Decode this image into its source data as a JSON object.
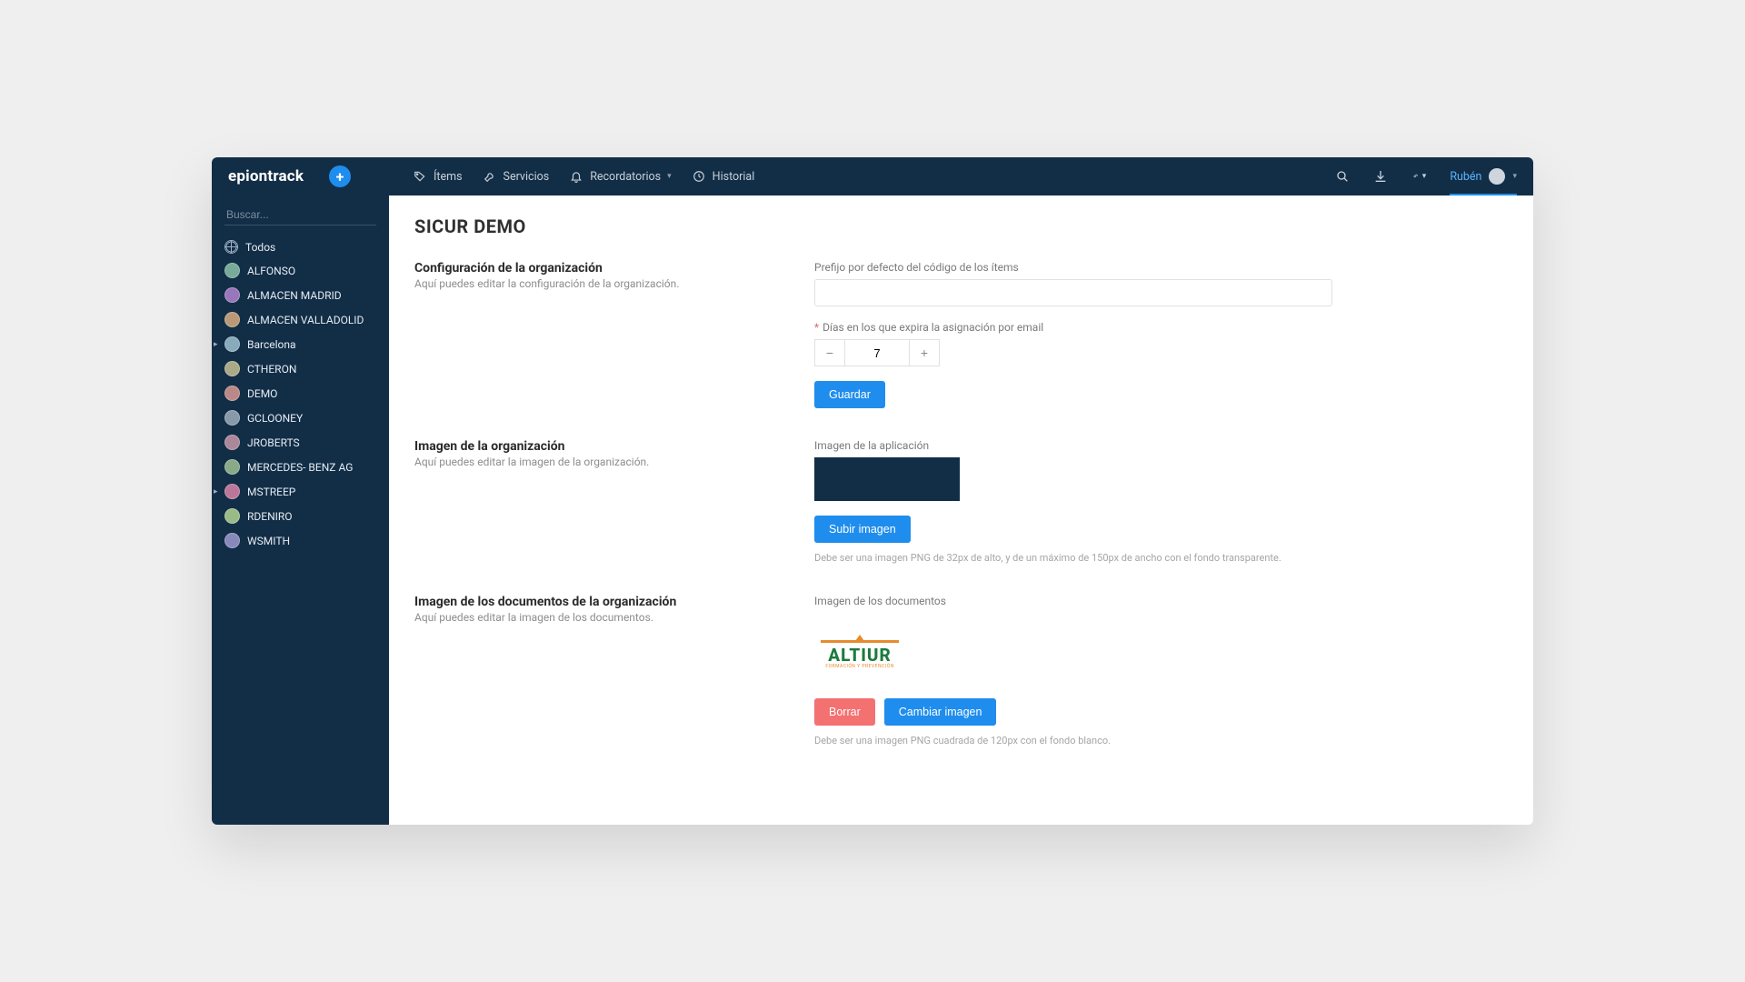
{
  "brand": "epiontrack",
  "nav": {
    "items_label": "Ítems",
    "services_label": "Servicios",
    "reminders_label": "Recordatorios",
    "history_label": "Historial"
  },
  "user": {
    "name": "Rubén"
  },
  "search": {
    "placeholder": "Buscar..."
  },
  "sidebar": {
    "items": [
      {
        "label": "Todos",
        "type": "all"
      },
      {
        "label": "ALFONSO",
        "type": "user"
      },
      {
        "label": "ALMACEN MADRID",
        "type": "user"
      },
      {
        "label": "ALMACEN VALLADOLID",
        "type": "user"
      },
      {
        "label": "Barcelona",
        "type": "user",
        "expandable": true
      },
      {
        "label": "CTHERON",
        "type": "user"
      },
      {
        "label": "DEMO",
        "type": "user"
      },
      {
        "label": "GCLOONEY",
        "type": "user"
      },
      {
        "label": "JROBERTS",
        "type": "user"
      },
      {
        "label": "MERCEDES- BENZ AG",
        "type": "user"
      },
      {
        "label": "MSTREEP",
        "type": "user",
        "expandable": true
      },
      {
        "label": "RDENIRO",
        "type": "user"
      },
      {
        "label": "WSMITH",
        "type": "user"
      }
    ]
  },
  "page": {
    "title": "SICUR DEMO",
    "org_config_title": "Configuración de la organización",
    "org_config_desc": "Aquí puedes editar la configuración de la organización.",
    "prefix_label": "Prefijo por defecto del código de los ítems",
    "prefix_value": "",
    "expire_label": "Días en los que expira la asignación por email",
    "expire_value": "7",
    "save_label": "Guardar",
    "org_image_title": "Imagen de la organización",
    "org_image_desc": "Aquí puedes editar la imagen de la organización.",
    "app_image_label": "Imagen de la aplicación",
    "upload_label": "Subir imagen",
    "app_image_hint": "Debe ser una imagen PNG de 32px de alto, y de un máximo de 150px de ancho con el fondo transparente.",
    "doc_image_section_title": "Imagen de los documentos de la organización",
    "doc_image_section_desc": "Aquí puedes editar la imagen de los documentos.",
    "doc_image_label": "Imagen de los documentos",
    "doc_logo_text": "ALTIUR",
    "doc_logo_sub": "FORMACIÓN Y PREVENCIÓN",
    "delete_label": "Borrar",
    "change_label": "Cambiar imagen",
    "doc_image_hint": "Debe ser una imagen PNG cuadrada de 120px con el fondo blanco."
  }
}
